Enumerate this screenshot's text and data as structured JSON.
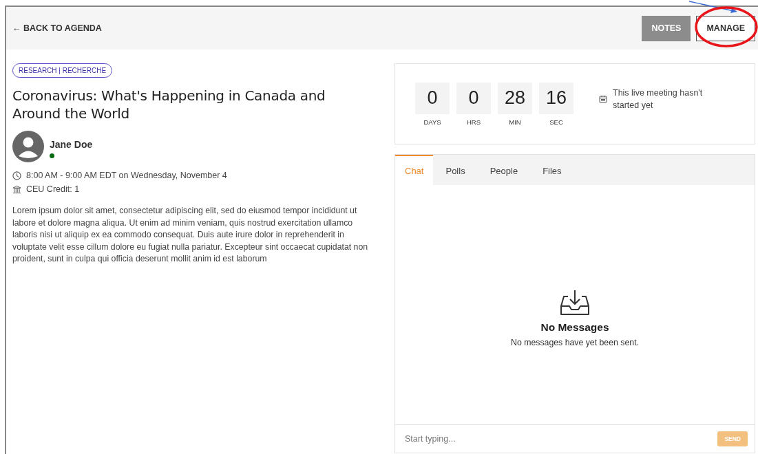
{
  "header": {
    "back_link": "← BACK TO AGENDA",
    "buttons": [
      {
        "label": "NOTES",
        "kind": "filled"
      },
      {
        "label": "MANAGE",
        "kind": "outline"
      }
    ]
  },
  "session": {
    "tag": "RESEARCH | RECHERCHE",
    "title": "Coronavirus: What's Happening in Canada and Around the World",
    "speaker": {
      "name": "Jane Doe",
      "online": true
    },
    "time": "8:00 AM - 9:00 AM EDT on Wednesday, November 4",
    "credit": "CEU Credit: 1",
    "description": "Lorem ipsum dolor sit amet, consectetur adipiscing elit, sed do eiusmod tempor incididunt ut labore et dolore magna aliqua. Ut enim ad minim veniam, quis nostrud exercitation ullamco laboris nisi ut aliquip ex ea commodo consequat. Duis aute irure dolor in reprehenderit in voluptate velit esse cillum dolore eu fugiat nulla pariatur. Excepteur sint occaecat cupidatat non proident, sunt in culpa qui officia deserunt mollit anim id est laborum"
  },
  "countdown": {
    "units": [
      {
        "value": "0",
        "label": "DAYS"
      },
      {
        "value": "0",
        "label": "HRS"
      },
      {
        "value": "28",
        "label": "MIN"
      },
      {
        "value": "16",
        "label": "SEC"
      }
    ],
    "status": "This live meeting hasn't started yet"
  },
  "tabs": [
    {
      "label": "Chat",
      "selected": true
    },
    {
      "label": "Polls",
      "selected": false
    },
    {
      "label": "People",
      "selected": false
    },
    {
      "label": "Files",
      "selected": false
    }
  ],
  "chat": {
    "empty_title": "No Messages",
    "empty_text": "No messages have yet been sent.",
    "input": {
      "placeholder": "Start typing..."
    },
    "send": {
      "label": "SEND",
      "disabled": true
    }
  }
}
